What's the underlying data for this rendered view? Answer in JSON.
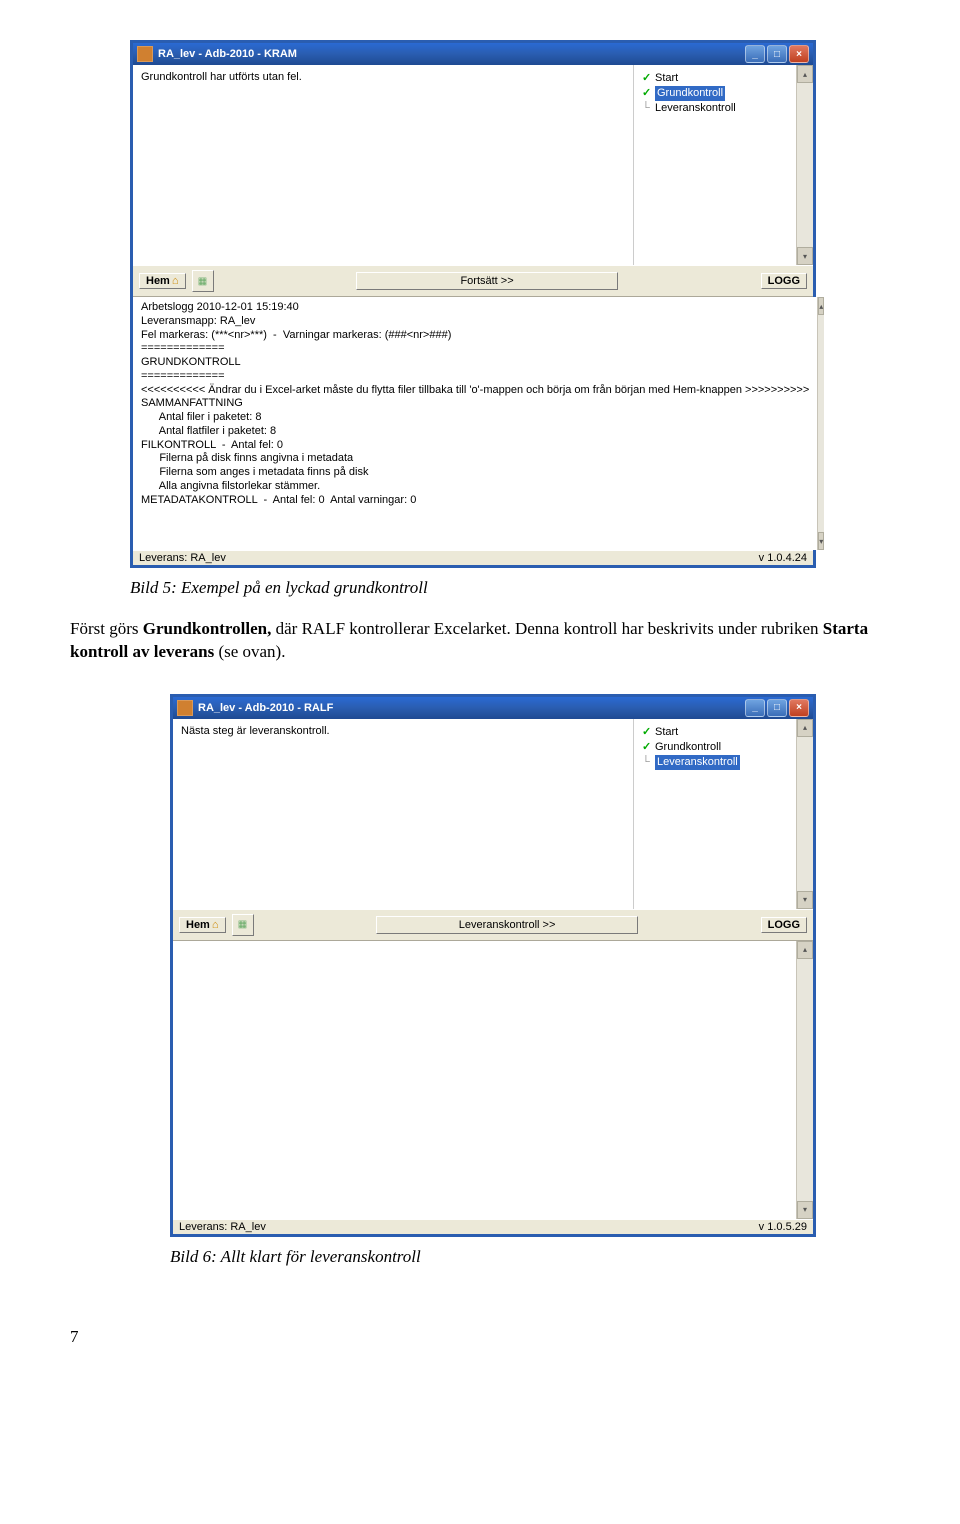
{
  "screenshot1": {
    "title": "RA_lev - Adb-2010 - KRAM",
    "message": "Grundkontroll har utförts utan fel.",
    "tree": [
      {
        "check": true,
        "label": "Start",
        "selected": false
      },
      {
        "check": true,
        "label": "Grundkontroll",
        "selected": true
      },
      {
        "check": false,
        "label": "Leveranskontroll",
        "selected": false
      }
    ],
    "hem_label": "Hem",
    "main_button": "Fortsätt >>",
    "logg_label": "LOGG",
    "log_lines": "Arbetslogg 2010-12-01 15:19:40\nLeveransmapp: RA_lev\nFel markeras: (***<nr>***)  -  Varningar markeras: (###<nr>###)\n=============\nGRUNDKONTROLL\n=============\n<<<<<<<<<< Ändrar du i Excel-arket måste du flytta filer tillbaka till 'o'-mappen och börja om från början med Hem-knappen >>>>>>>>>>\nSAMMANFATTNING\n      Antal filer i paketet: 8\n      Antal flatfiler i paketet: 8\nFILKONTROLL  -  Antal fel: 0\n      Filerna på disk finns angivna i metadata\n      Filerna som anges i metadata finns på disk\n      Alla angivna filstorlekar stämmer.\nMETADATAKONTROLL  -  Antal fel: 0  Antal varningar: 0",
    "status_left": "Leverans: RA_lev",
    "status_right": "v 1.0.4.24"
  },
  "caption1": "Bild 5: Exempel på en lyckad grundkontroll",
  "body": {
    "p1a": "Först görs ",
    "p1b": "Grundkontrollen,",
    "p1c": " där RALF kontrollerar Excelarket. Denna kontroll har beskrivits under rubriken ",
    "p1d": "Starta kontroll av leverans",
    "p1e": " (se ovan)."
  },
  "screenshot2": {
    "title": "RA_lev - Adb-2010 - RALF",
    "message": "Nästa steg är leveranskontroll.",
    "tree": [
      {
        "check": true,
        "label": "Start",
        "selected": false
      },
      {
        "check": true,
        "label": "Grundkontroll",
        "selected": false
      },
      {
        "check": false,
        "label": "Leveranskontroll",
        "selected": true
      }
    ],
    "hem_label": "Hem",
    "main_button": "Leveranskontroll >>",
    "logg_label": "LOGG",
    "log_lines": "",
    "status_left": "Leverans: RA_lev",
    "status_right": "v 1.0.5.29"
  },
  "caption2": "Bild 6: Allt klart för leveranskontroll",
  "page_number": "7"
}
